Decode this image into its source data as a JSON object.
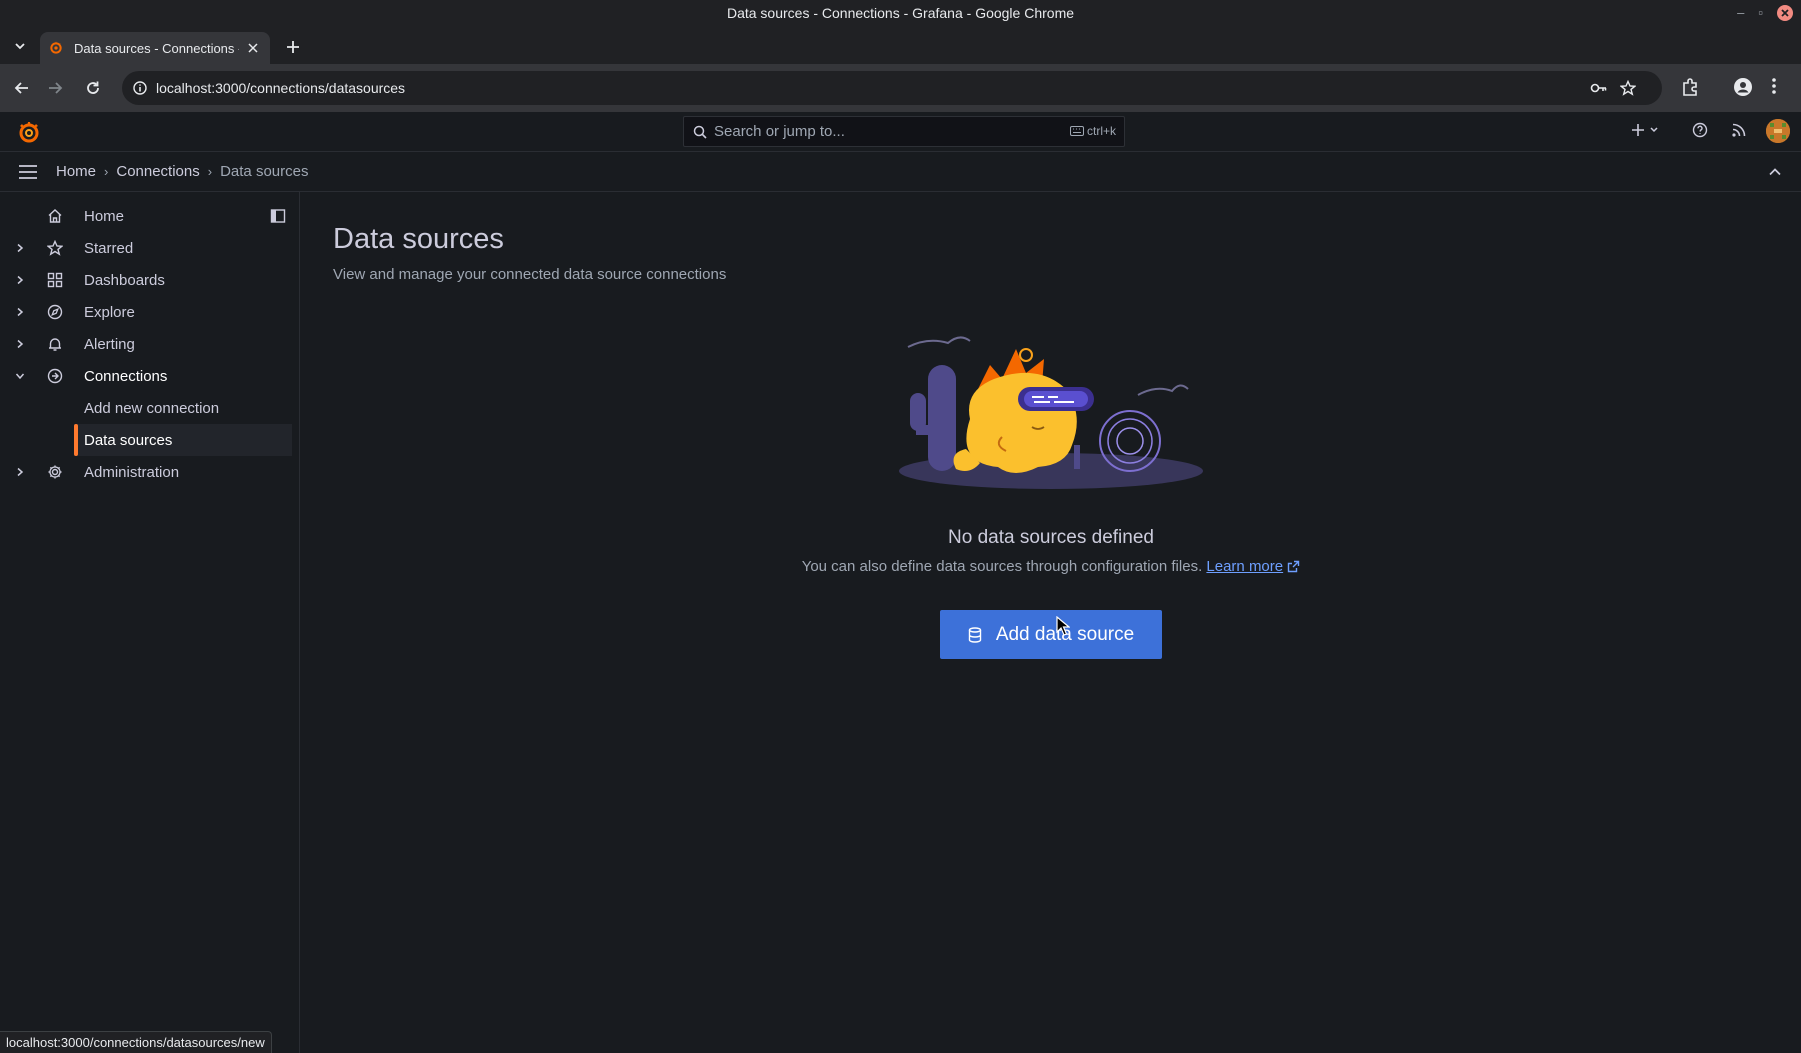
{
  "window": {
    "title": "Data sources - Connections - Grafana - Google Chrome"
  },
  "browser": {
    "tab_title": "Data sources - Connections - Grafana",
    "url": "localhost:3000/connections/datasources",
    "status_url": "localhost:3000/connections/datasources/new"
  },
  "topbar": {
    "search_placeholder": "Search or jump to...",
    "shortcut": "ctrl+k"
  },
  "breadcrumb": {
    "home": "Home",
    "connections": "Connections",
    "current": "Data sources"
  },
  "sidebar": {
    "items": [
      {
        "label": "Home",
        "icon": "home-icon"
      },
      {
        "label": "Starred",
        "icon": "star-icon"
      },
      {
        "label": "Dashboards",
        "icon": "apps-icon"
      },
      {
        "label": "Explore",
        "icon": "compass-icon"
      },
      {
        "label": "Alerting",
        "icon": "bell-icon"
      },
      {
        "label": "Connections",
        "icon": "connections-icon"
      },
      {
        "label": "Administration",
        "icon": "cog-icon"
      }
    ],
    "sub_items": [
      {
        "label": "Add new connection"
      },
      {
        "label": "Data sources",
        "active": true
      }
    ]
  },
  "main": {
    "title": "Data sources",
    "subtitle": "View and manage your connected data source connections",
    "empty_title": "No data sources defined",
    "empty_desc": "You can also define data sources through configuration files.",
    "learn_more": "Learn more",
    "add_button": "Add data source"
  },
  "colors": {
    "accent": "#3d71d9",
    "active_marker": "#ff7a2e",
    "link": "#6e9fff"
  }
}
